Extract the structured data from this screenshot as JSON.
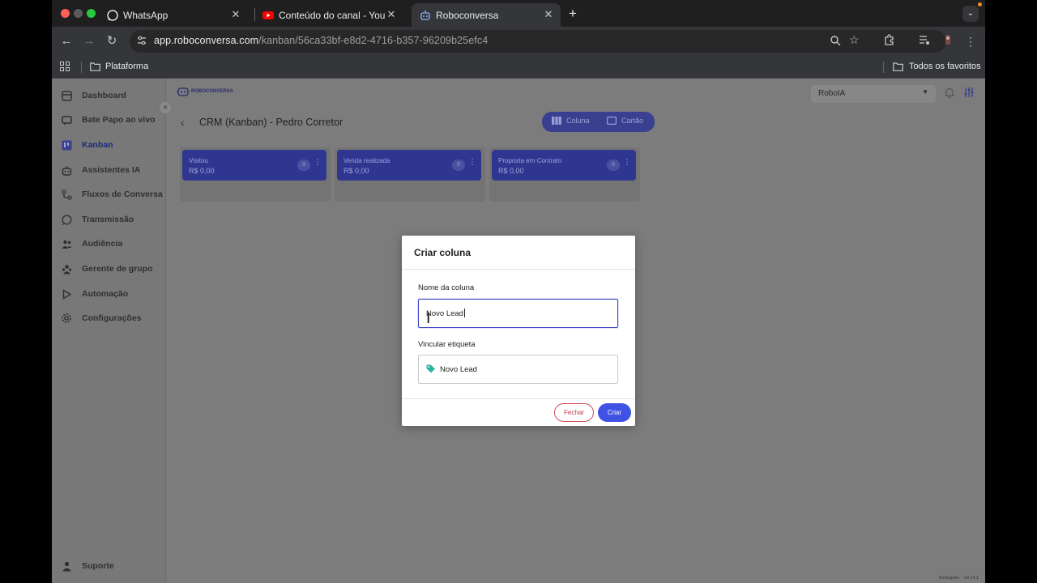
{
  "browser": {
    "tabs": [
      {
        "title": "WhatsApp",
        "icon": "whatsapp-icon"
      },
      {
        "title": "Conteúdo do canal - YouTube",
        "icon": "youtube-icon"
      },
      {
        "title": "Roboconversa",
        "icon": "roboconversa-icon",
        "active": true
      }
    ],
    "new_tab": "+",
    "url_host": "app.roboconversa.com",
    "url_path": "/kanban/56ca33bf-e8d2-4716-b357-96209b25efc4",
    "bookmarks": {
      "folder": "Plataforma",
      "all": "Todos os favoritos"
    }
  },
  "sidebar": {
    "items": [
      {
        "label": "Dashboard",
        "icon": "dashboard-icon"
      },
      {
        "label": "Bate Papo ao vivo",
        "icon": "chat-icon"
      },
      {
        "label": "Kanban",
        "icon": "kanban-icon",
        "active": true
      },
      {
        "label": "Assistentes IA",
        "icon": "robot-icon"
      },
      {
        "label": "Fluxos de Conversa",
        "icon": "flow-icon"
      },
      {
        "label": "Transmissão",
        "icon": "broadcast-icon"
      },
      {
        "label": "Audiência",
        "icon": "audience-icon"
      },
      {
        "label": "Gerente de grupo",
        "icon": "group-icon"
      },
      {
        "label": "Automação",
        "icon": "play-icon"
      },
      {
        "label": "Configurações",
        "icon": "gear-icon"
      }
    ],
    "support": "Suporte",
    "collapse": "«"
  },
  "header": {
    "logo_text": "ROBOCONVERSA",
    "company": "RoboIA"
  },
  "board": {
    "title": "CRM (Kanban) - Pedro Corretor",
    "view_toggle": {
      "column": "Coluna",
      "card": "Cartão"
    },
    "columns": [
      {
        "name": "Visitou",
        "value": "R$ 0,00",
        "count": "0"
      },
      {
        "name": "Venda realizada",
        "value": "R$ 0,00",
        "count": "0"
      },
      {
        "name": "Proposta em Contrato",
        "value": "R$ 0,00",
        "count": "0"
      }
    ]
  },
  "modal": {
    "title": "Criar coluna",
    "name_label": "Nome da coluna",
    "name_value": "Novo Lead",
    "tag_label": "Vincular etiqueta",
    "tag_value": "Novo Lead",
    "tag_color": "#2bb5a0",
    "close_button": "Fechar",
    "create_button": "Criar"
  },
  "footer": {
    "language": "Português",
    "version": "v3.14.1"
  },
  "colors": {
    "accent": "#3f52e4",
    "danger": "#c43a49",
    "kanban_column": "#2f3690"
  }
}
